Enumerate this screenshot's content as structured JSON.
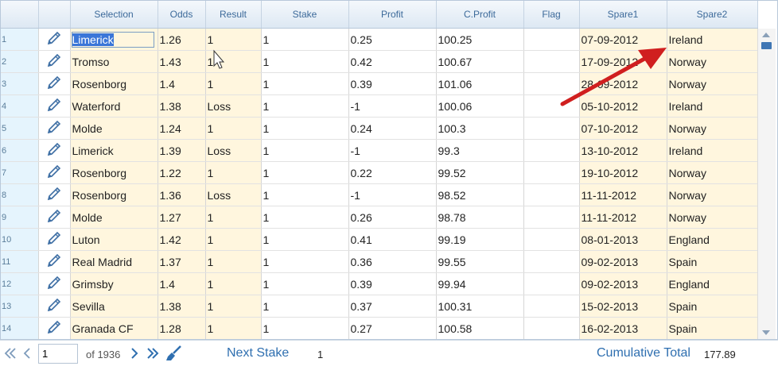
{
  "columns": [
    "",
    "",
    "Selection",
    "Odds",
    "Result",
    "Stake",
    "Profit",
    "C.Profit",
    "Flag",
    "Spare1",
    "Spare2"
  ],
  "rows": [
    {
      "n": "1",
      "selection": "Limerick",
      "odds": "1.26",
      "result": "1",
      "stake": "1",
      "profit": "0.25",
      "cprofit": "100.25",
      "flag": "",
      "spare1": "07-09-2012",
      "spare2": "Ireland"
    },
    {
      "n": "2",
      "selection": "Tromso",
      "odds": "1.43",
      "result": "1",
      "stake": "1",
      "profit": "0.42",
      "cprofit": "100.67",
      "flag": "",
      "spare1": "17-09-2012",
      "spare2": "Norway"
    },
    {
      "n": "3",
      "selection": "Rosenborg",
      "odds": "1.4",
      "result": "1",
      "stake": "1",
      "profit": "0.39",
      "cprofit": "101.06",
      "flag": "",
      "spare1": "28-09-2012",
      "spare2": "Norway"
    },
    {
      "n": "4",
      "selection": "Waterford",
      "odds": "1.38",
      "result": "Loss",
      "stake": "1",
      "profit": "-1",
      "cprofit": "100.06",
      "flag": "",
      "spare1": "05-10-2012",
      "spare2": "Ireland"
    },
    {
      "n": "5",
      "selection": "Molde",
      "odds": "1.24",
      "result": "1",
      "stake": "1",
      "profit": "0.24",
      "cprofit": "100.3",
      "flag": "",
      "spare1": "07-10-2012",
      "spare2": "Norway"
    },
    {
      "n": "6",
      "selection": "Limerick",
      "odds": "1.39",
      "result": "Loss",
      "stake": "1",
      "profit": "-1",
      "cprofit": "99.3",
      "flag": "",
      "spare1": "13-10-2012",
      "spare2": "Ireland"
    },
    {
      "n": "7",
      "selection": "Rosenborg",
      "odds": "1.22",
      "result": "1",
      "stake": "1",
      "profit": "0.22",
      "cprofit": "99.52",
      "flag": "",
      "spare1": "19-10-2012",
      "spare2": "Norway"
    },
    {
      "n": "8",
      "selection": "Rosenborg",
      "odds": "1.36",
      "result": "Loss",
      "stake": "1",
      "profit": "-1",
      "cprofit": "98.52",
      "flag": "",
      "spare1": "11-11-2012",
      "spare2": "Norway"
    },
    {
      "n": "9",
      "selection": "Molde",
      "odds": "1.27",
      "result": "1",
      "stake": "1",
      "profit": "0.26",
      "cprofit": "98.78",
      "flag": "",
      "spare1": "11-11-2012",
      "spare2": "Norway"
    },
    {
      "n": "10",
      "selection": "Luton",
      "odds": "1.42",
      "result": "1",
      "stake": "1",
      "profit": "0.41",
      "cprofit": "99.19",
      "flag": "",
      "spare1": "08-01-2013",
      "spare2": "England"
    },
    {
      "n": "11",
      "selection": "Real Madrid",
      "odds": "1.37",
      "result": "1",
      "stake": "1",
      "profit": "0.36",
      "cprofit": "99.55",
      "flag": "",
      "spare1": "09-02-2013",
      "spare2": "Spain"
    },
    {
      "n": "12",
      "selection": "Grimsby",
      "odds": "1.4",
      "result": "1",
      "stake": "1",
      "profit": "0.39",
      "cprofit": "99.94",
      "flag": "",
      "spare1": "09-02-2013",
      "spare2": "England"
    },
    {
      "n": "13",
      "selection": "Sevilla",
      "odds": "1.38",
      "result": "1",
      "stake": "1",
      "profit": "0.37",
      "cprofit": "100.31",
      "flag": "",
      "spare1": "15-02-2013",
      "spare2": "Spain"
    },
    {
      "n": "14",
      "selection": "Granada CF",
      "odds": "1.28",
      "result": "1",
      "stake": "1",
      "profit": "0.27",
      "cprofit": "100.58",
      "flag": "",
      "spare1": "16-02-2013",
      "spare2": "Spain"
    }
  ],
  "icons": {
    "edit": "pencil-icon",
    "first": "double-chevron-left-icon",
    "prev": "chevron-left-icon",
    "next": "chevron-right-icon",
    "last": "double-chevron-right-icon",
    "clear": "brush-icon"
  },
  "pager": {
    "page_value": "1",
    "of_label": "of 1936",
    "next_stake_label": "Next Stake",
    "next_stake_value": "1",
    "cumulative_label": "Cumulative Total",
    "cumulative_value": "177.89"
  },
  "colors": {
    "accent": "#2f6fb0",
    "cell_highlight": "#fff6de",
    "selection": "#3a76d8",
    "arrow": "#d01f1f"
  }
}
